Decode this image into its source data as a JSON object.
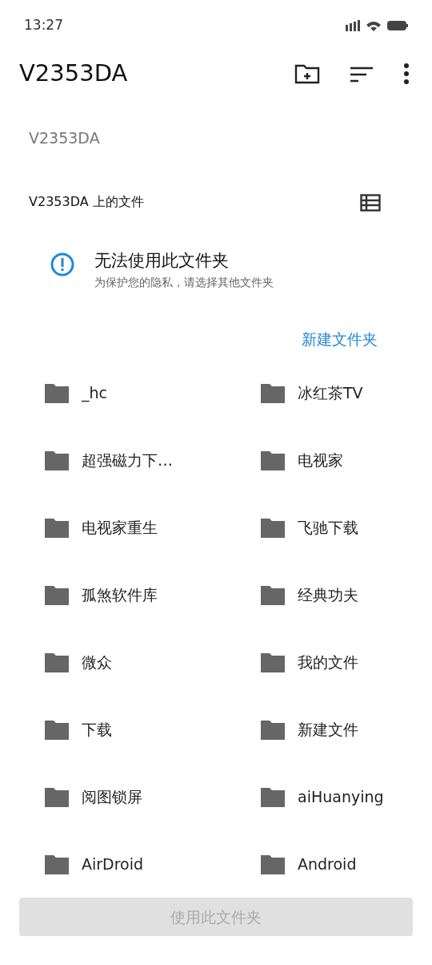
{
  "status_bar": {
    "time": "13:27"
  },
  "app_bar": {
    "title": "V2353DA"
  },
  "breadcrumb": "V2353DA",
  "section": {
    "title": "V2353DA 上的文件"
  },
  "notice": {
    "title": "无法使用此文件夹",
    "message": "为保护您的隐私，请选择其他文件夹"
  },
  "new_folder_link": "新建文件夹",
  "folders": [
    {
      "name": "_hc"
    },
    {
      "name": "冰红茶TV"
    },
    {
      "name": "超强磁力下…"
    },
    {
      "name": "电视家"
    },
    {
      "name": "电视家重生"
    },
    {
      "name": "飞驰下载"
    },
    {
      "name": "孤煞软件库"
    },
    {
      "name": "经典功夫"
    },
    {
      "name": "微众"
    },
    {
      "name": "我的文件"
    },
    {
      "name": "下载"
    },
    {
      "name": "新建文件"
    },
    {
      "name": "阅图锁屏"
    },
    {
      "name": "aiHuanying"
    },
    {
      "name": "AirDroid"
    },
    {
      "name": "Android"
    }
  ],
  "use_button": {
    "label": "使用此文件夹",
    "disabled": true
  }
}
